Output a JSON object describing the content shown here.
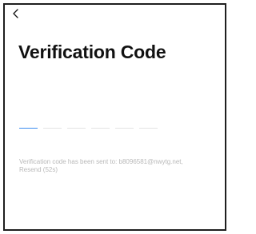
{
  "header": {
    "back_icon": "chevron-left-icon"
  },
  "page": {
    "title": "Verification Code"
  },
  "code": {
    "slots": 6,
    "active_index": 0
  },
  "info": {
    "sent_text": "Verification code has been sent to: b8096581@nwytg.net,",
    "resend_label": "Resend (52s)"
  },
  "colors": {
    "accent": "#3d8ef0",
    "slot_line": "#e3e3e3",
    "muted_text": "#b8b8b8"
  }
}
